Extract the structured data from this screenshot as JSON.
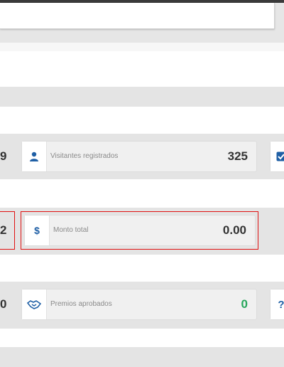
{
  "cards": {
    "visitantes": {
      "label": "Visitantes registrados",
      "value": "325",
      "icon": "user-icon"
    },
    "monto": {
      "label": "Monto total",
      "value": "0.00",
      "icon": "dollar-icon",
      "icon_glyph": "$"
    },
    "premios": {
      "label": "Premios aprobados",
      "value": "0",
      "icon": "handshake-icon"
    }
  },
  "edge_left": {
    "row1": "9",
    "row2": "2",
    "row3": "0"
  },
  "edge_right": {
    "row3_glyph": "?"
  },
  "colors": {
    "accent": "#1f5fa5",
    "highlight": "#e01010",
    "success": "#26a65b"
  }
}
